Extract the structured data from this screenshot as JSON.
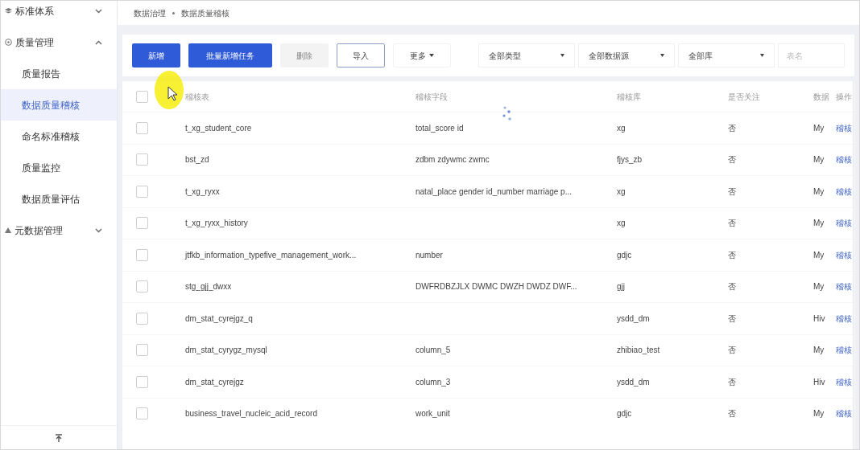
{
  "sidebar": {
    "items": [
      {
        "label": "标准体系",
        "expanded": false
      },
      {
        "label": "质量管理",
        "expanded": true,
        "children": [
          {
            "label": "质量报告",
            "selected": false
          },
          {
            "label": "数据质量稽核",
            "selected": true
          },
          {
            "label": "命名标准稽核",
            "selected": false
          },
          {
            "label": "质量监控",
            "selected": false
          },
          {
            "label": "数据质量评估",
            "selected": false
          }
        ]
      },
      {
        "label": "元数据管理",
        "expanded": false
      }
    ]
  },
  "breadcrumb": [
    "数据治理",
    "数据质量稽核"
  ],
  "toolbar": {
    "buttons": [
      {
        "label": "新增",
        "kind": "primary",
        "disabled": false
      },
      {
        "label": "批量新增任务",
        "kind": "primary",
        "disabled": false
      },
      {
        "label": "删除",
        "kind": "plain",
        "disabled": true
      },
      {
        "label": "导入",
        "kind": "outline",
        "disabled": false
      },
      {
        "label": "更多",
        "kind": "dropdown",
        "disabled": false
      }
    ],
    "filters": [
      "全部类型",
      "全部数据源",
      "全部库"
    ],
    "search": {
      "placeholder": "表名"
    }
  },
  "table": {
    "select_all": false,
    "columns": [
      "稽核表",
      "稽核字段",
      "稽核库",
      "是否关注",
      "数据",
      "操作"
    ],
    "rows": [
      {
        "table": "t_xg_student_core",
        "field": "total_score id",
        "db": "xg",
        "followed": "否",
        "source": "My",
        "action": "稽核",
        "checked": false
      },
      {
        "table": "bst_zd",
        "field": "zdbm zdywmc zwmc",
        "db": "fjys_zb",
        "followed": "否",
        "source": "My",
        "action": "稽核",
        "checked": false
      },
      {
        "table": "t_xg_ryxx",
        "field": "natal_place gender id_number marriage p...",
        "db": "xg",
        "followed": "否",
        "source": "My",
        "action": "稽核",
        "checked": false
      },
      {
        "table": "t_xg_ryxx_history",
        "db": "xg",
        "followed": "否",
        "source": "My",
        "action": "稽核",
        "checked": false
      },
      {
        "table": "jtfkb_information_typefive_management_work...",
        "field": "number",
        "db": "gdjc",
        "followed": "否",
        "source": "My",
        "action": "稽核",
        "checked": false
      },
      {
        "table": "stg_gjj_dwxx",
        "field": "DWFRDBZJLX DWMC DWZH DWDZ DWF...",
        "db": "gjj",
        "followed": "否",
        "source": "My",
        "action": "稽核",
        "checked": false
      },
      {
        "table": "dm_stat_cyrejgz_q",
        "db": "ysdd_dm",
        "followed": "否",
        "source": "Hiv",
        "action": "稽核",
        "checked": false
      },
      {
        "table": "dm_stat_cyrygz_mysql",
        "field": "column_5",
        "db": "zhibiao_test",
        "followed": "否",
        "source": "My",
        "action": "稽核",
        "checked": false
      },
      {
        "table": "dm_stat_cyrejgz",
        "field": "column_3",
        "db": "ysdd_dm",
        "followed": "否",
        "source": "Hiv",
        "action": "稽核",
        "checked": false
      },
      {
        "table": "business_travel_nucleic_acid_record",
        "field": "work_unit",
        "db": "gdjc",
        "followed": "否",
        "source": "My",
        "action": "稽核",
        "checked": false
      }
    ]
  }
}
